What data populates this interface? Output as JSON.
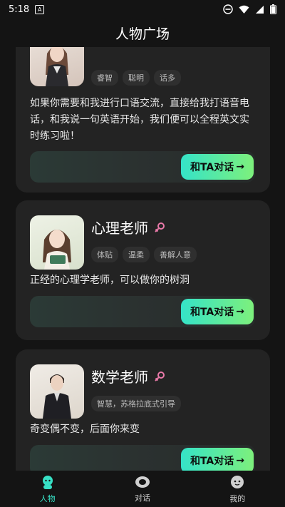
{
  "status_bar": {
    "time": "5:18",
    "notification_badge": "A"
  },
  "header": {
    "title": "人物广场"
  },
  "cards": [
    {
      "name": "",
      "tags": [
        "睿智",
        "聪明",
        "话多"
      ],
      "desc": "如果你需要和我进行口语交流，直接给我打语音电话，和我说一句英语开始，我们便可以全程英文实时练习啦！",
      "button": "和TA对话"
    },
    {
      "name": "心理老师",
      "tags": [
        "体贴",
        "温柔",
        "善解人意"
      ],
      "desc": "正经的心理学老师，可以做你的树洞",
      "button": "和TA对话"
    },
    {
      "name": "数学老师",
      "tags": [
        "智慧，苏格拉底式引导"
      ],
      "desc": "奇变偶不变，后面你来变",
      "button": "和TA对话"
    }
  ],
  "tabbar": {
    "items": [
      {
        "label": "人物",
        "active": true
      },
      {
        "label": "对话",
        "active": false
      },
      {
        "label": "我的",
        "active": false
      }
    ]
  },
  "colors": {
    "accent": "#37e0c5",
    "female": "#e879a8"
  }
}
